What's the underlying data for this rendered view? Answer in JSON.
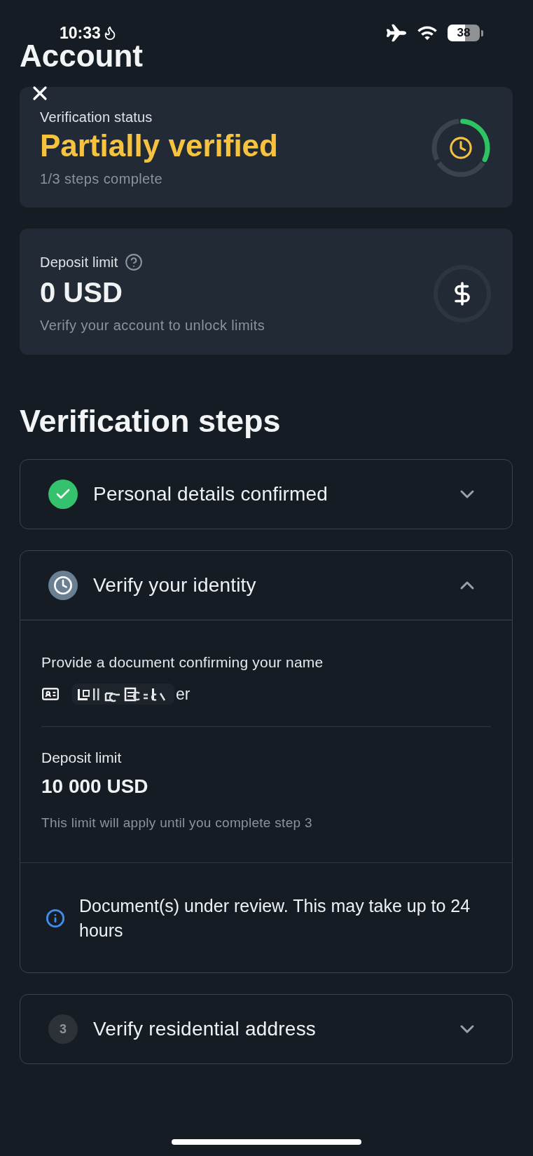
{
  "status_bar": {
    "time": "10:33",
    "battery": "38"
  },
  "header": {
    "title": "Account"
  },
  "status_card": {
    "label": "Verification status",
    "status": "Partially verified",
    "progress": "1/3 steps complete",
    "ring_segments": [
      {
        "filled": true
      },
      {
        "filled": false
      },
      {
        "filled": false
      }
    ]
  },
  "limit_card": {
    "label": "Deposit limit",
    "amount": "0 USD",
    "note": "Verify your account to unlock limits"
  },
  "steps_section": {
    "title": "Verification steps",
    "steps": [
      {
        "kind": "done",
        "title": "Personal details confirmed",
        "expanded": false
      },
      {
        "kind": "pending",
        "title": "Verify your identity",
        "expanded": true,
        "details": {
          "prompt": "Provide a document confirming your name",
          "document": "er",
          "limit_label": "Deposit limit",
          "limit_amount": "10 000 USD",
          "limit_note": "This limit will apply until you complete step 3",
          "notice": "Document(s) under review. This may take up to 24 hours"
        }
      },
      {
        "kind": "todo",
        "number": "3",
        "title": "Verify residential address",
        "expanded": false
      }
    ]
  }
}
